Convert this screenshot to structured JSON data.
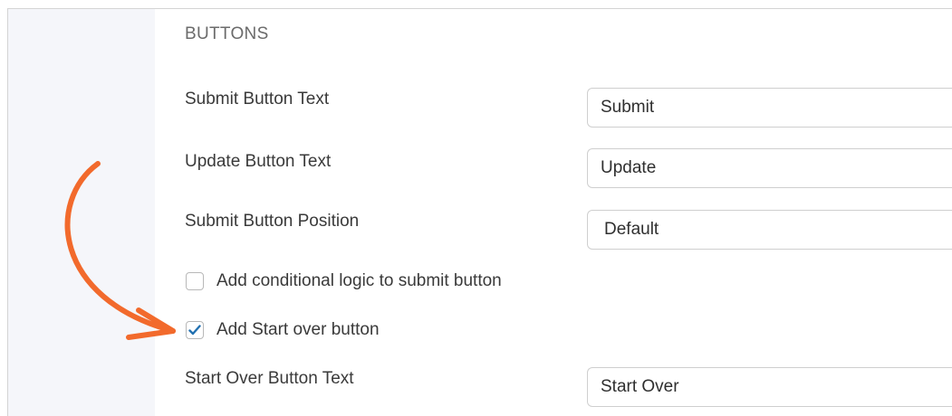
{
  "section": {
    "title": "BUTTONS"
  },
  "fields": {
    "submit_text": {
      "label": "Submit Button Text",
      "value": "Submit"
    },
    "update_text": {
      "label": "Update Button Text",
      "value": "Update"
    },
    "submit_position": {
      "label": "Submit Button Position",
      "value": "Default"
    },
    "start_over_text": {
      "label": "Start Over Button Text",
      "value": "Start Over"
    }
  },
  "checkboxes": {
    "conditional_logic": {
      "label": "Add conditional logic to submit button",
      "checked": false
    },
    "start_over": {
      "label": "Add Start over button",
      "checked": true
    }
  },
  "colors": {
    "accent": "#2271b1",
    "annotation": "#f26a2c",
    "sidebar": "#f5f6fa"
  }
}
